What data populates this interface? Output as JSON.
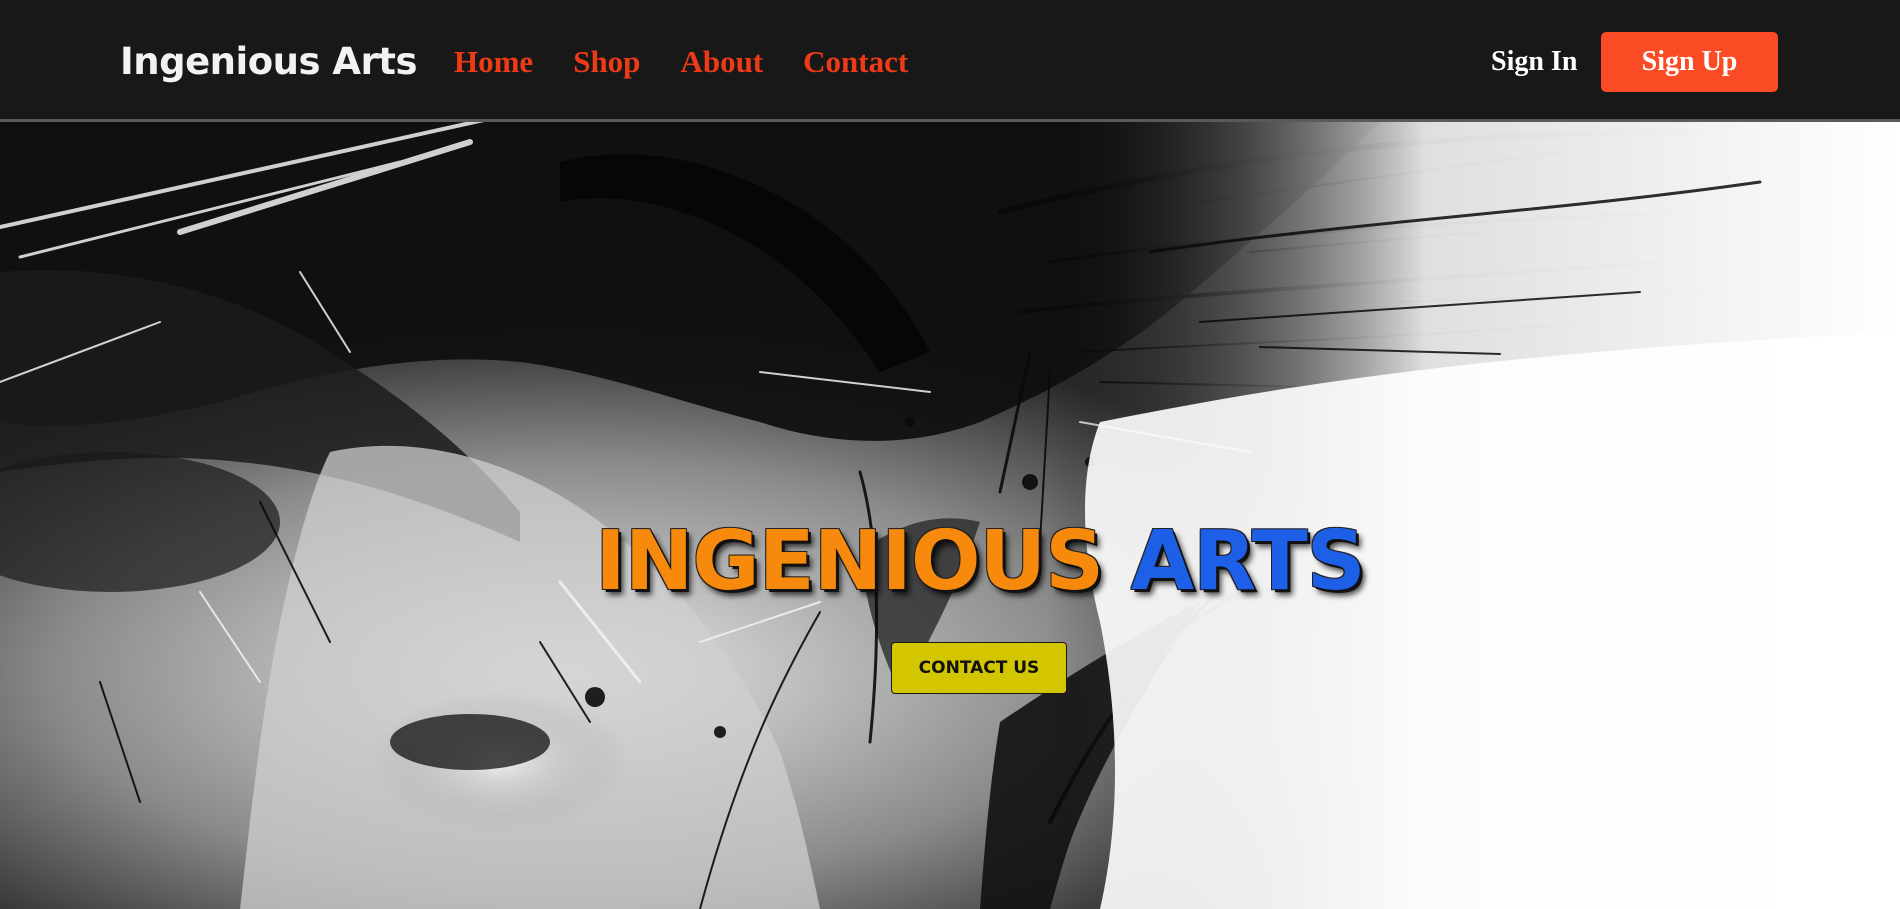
{
  "navbar": {
    "brand": "Ingenious Arts",
    "links": [
      {
        "label": "Home"
      },
      {
        "label": "Shop"
      },
      {
        "label": "About"
      },
      {
        "label": "Contact"
      }
    ],
    "sign_in_label": "Sign In",
    "sign_up_label": "Sign Up"
  },
  "hero": {
    "title_part1": "INGENIOUS",
    "title_part2": "ARTS",
    "cta_label": "CONTACT US",
    "background_image": "abstract black-and-white ink splatter portrait"
  },
  "colors": {
    "navbar_bg": "#181818",
    "nav_link": "#ee3a16",
    "sign_up_bg": "#fb4b25",
    "title_orange": "#f78a0c",
    "title_blue": "#1d5fe6",
    "cta_bg": "#d3c600"
  }
}
